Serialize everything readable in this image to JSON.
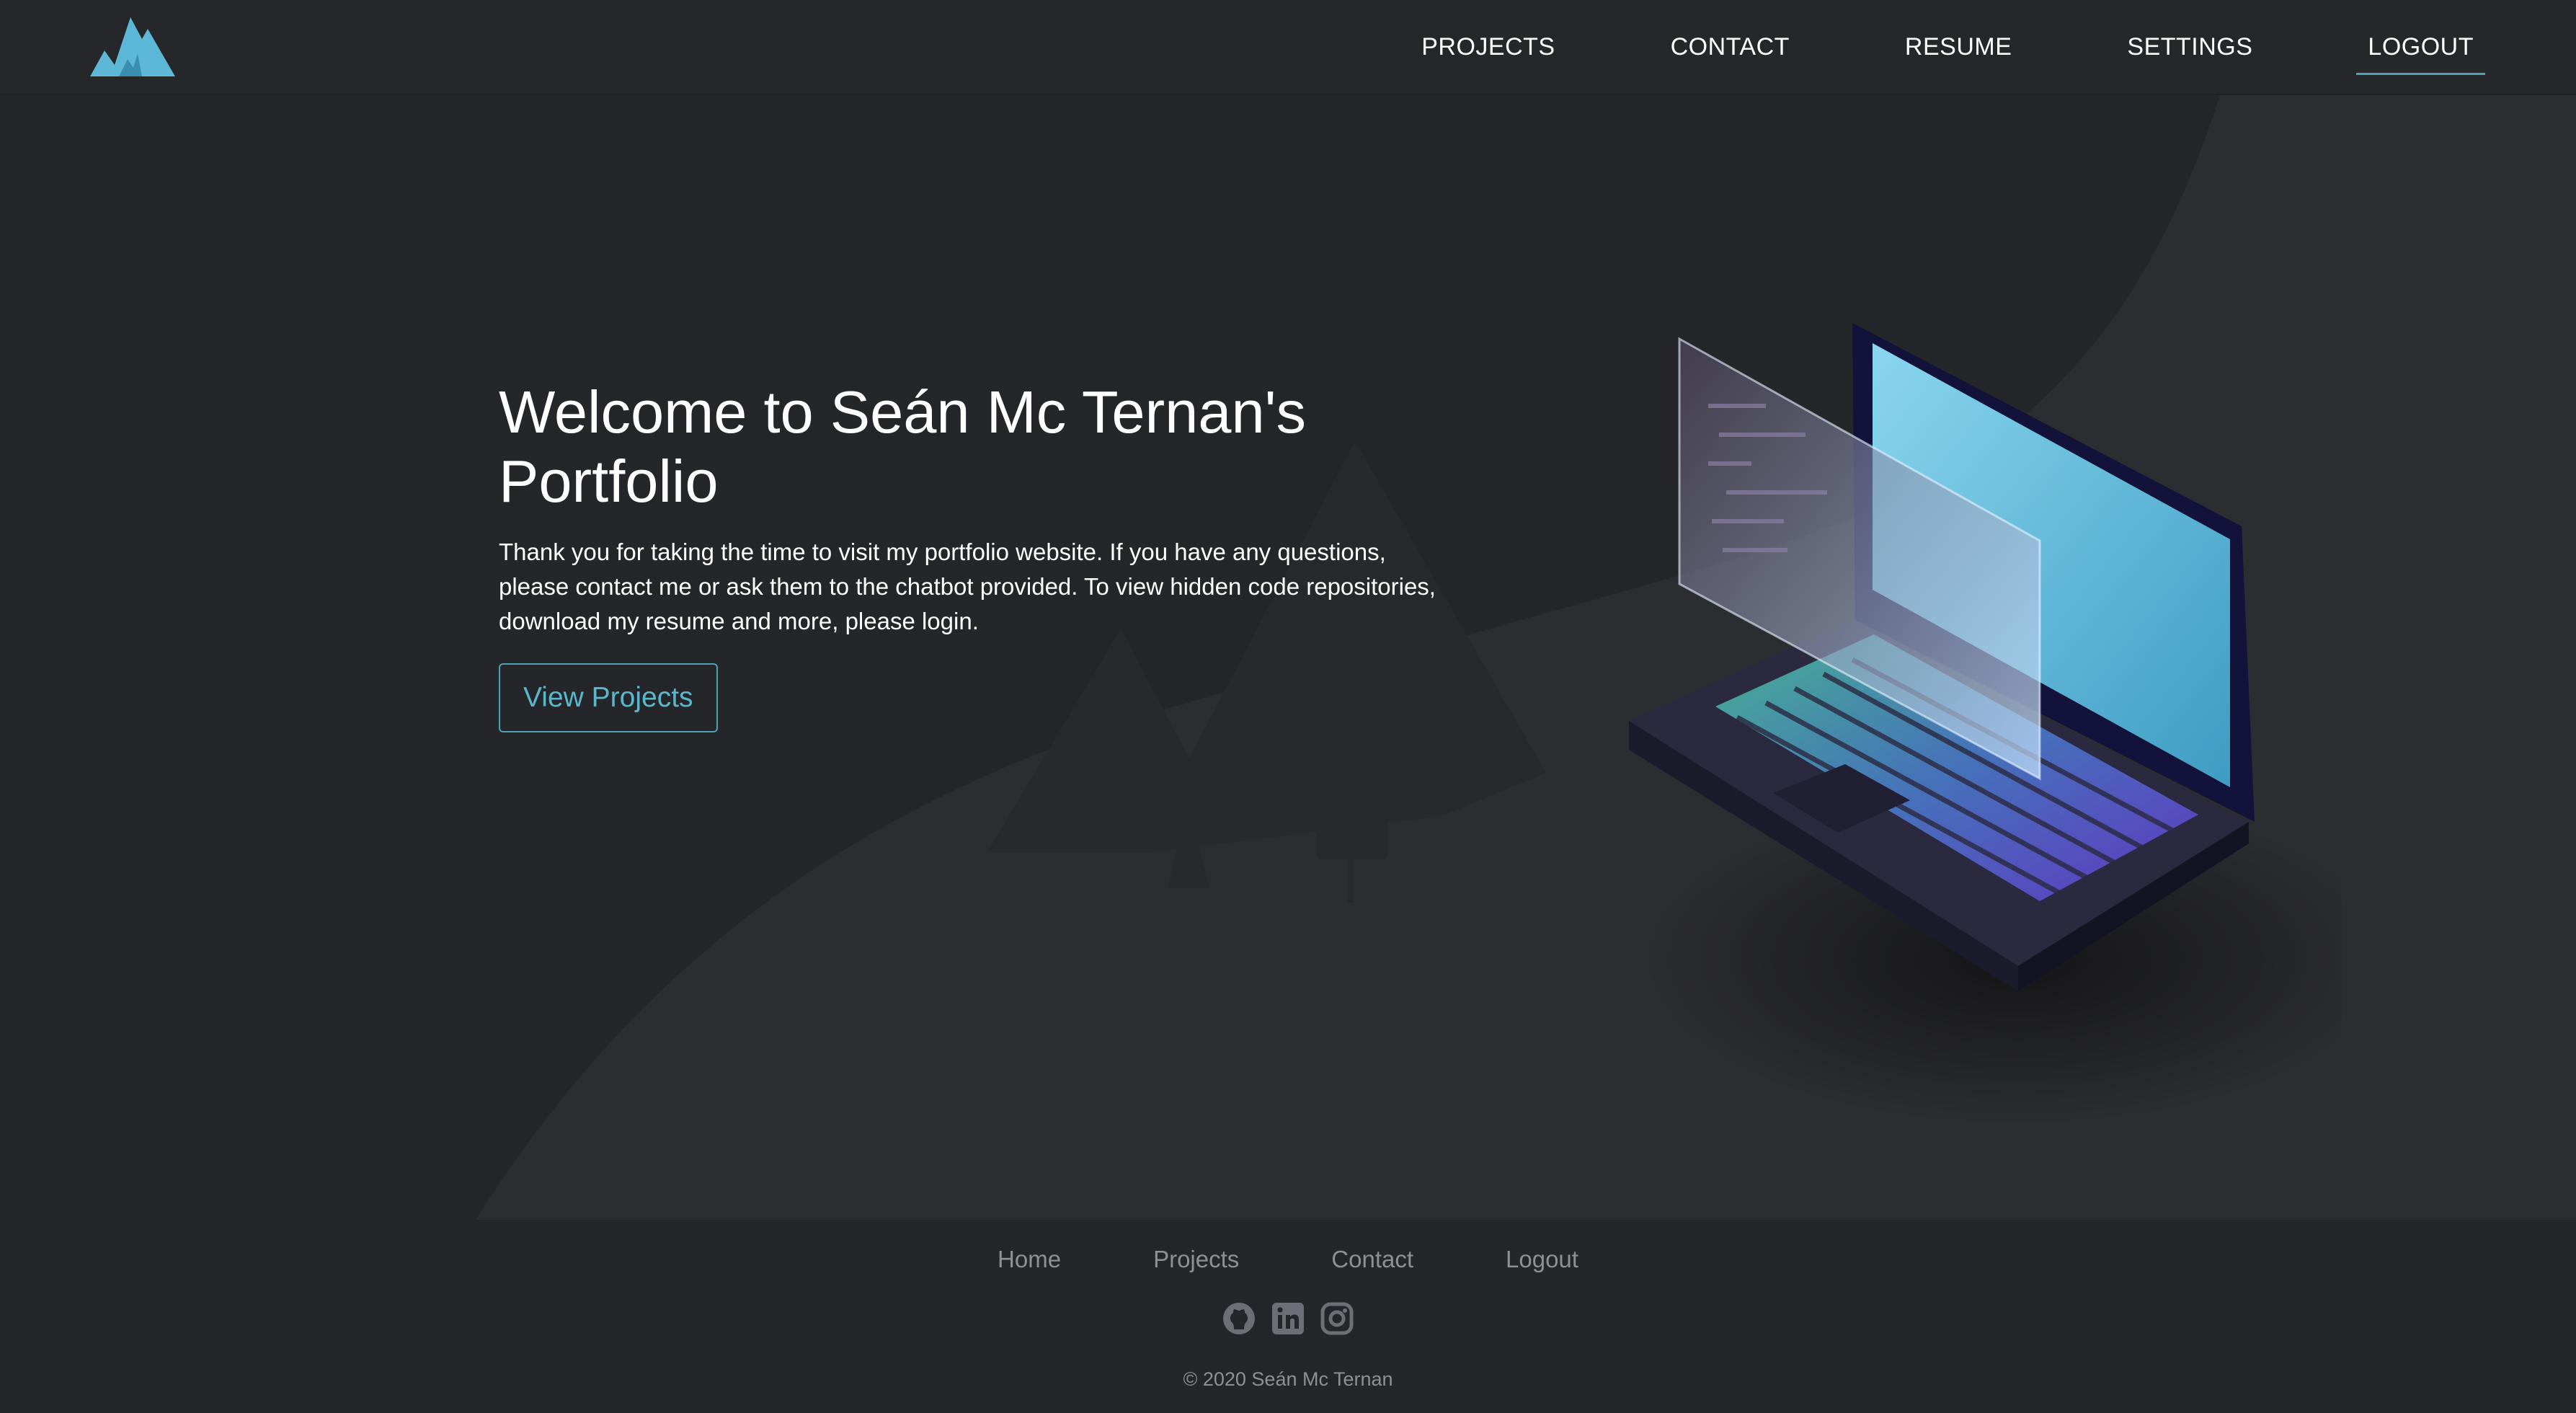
{
  "brand": {
    "logo_icon": "mountain-logo-icon",
    "accent": "#4aa3b8",
    "logo_color": "#5cb8d6"
  },
  "nav": {
    "items": [
      {
        "label": "PROJECTS"
      },
      {
        "label": "CONTACT"
      },
      {
        "label": "RESUME"
      },
      {
        "label": "SETTINGS"
      },
      {
        "label": "LOGOUT",
        "active": true
      }
    ]
  },
  "hero": {
    "title": "Welcome to Seán Mc Ternan's Portfolio",
    "description": "Thank you for taking the time to visit my portfolio website. If you have any questions, please contact me or ask them to the chatbot provided. To view hidden code repositories, download my resume and more, please login.",
    "cta_label": "View Projects",
    "illustration": "isometric-laptop-illustration"
  },
  "footer": {
    "links": [
      "Home",
      "Projects",
      "Contact",
      "Logout"
    ],
    "socials": [
      "github-icon",
      "linkedin-icon",
      "instagram-icon"
    ],
    "copyright": "© 2020 Seán Mc Ternan"
  },
  "colors": {
    "background": "#252629",
    "nav_bg": "#26272a",
    "muted_text": "#8d9096"
  }
}
